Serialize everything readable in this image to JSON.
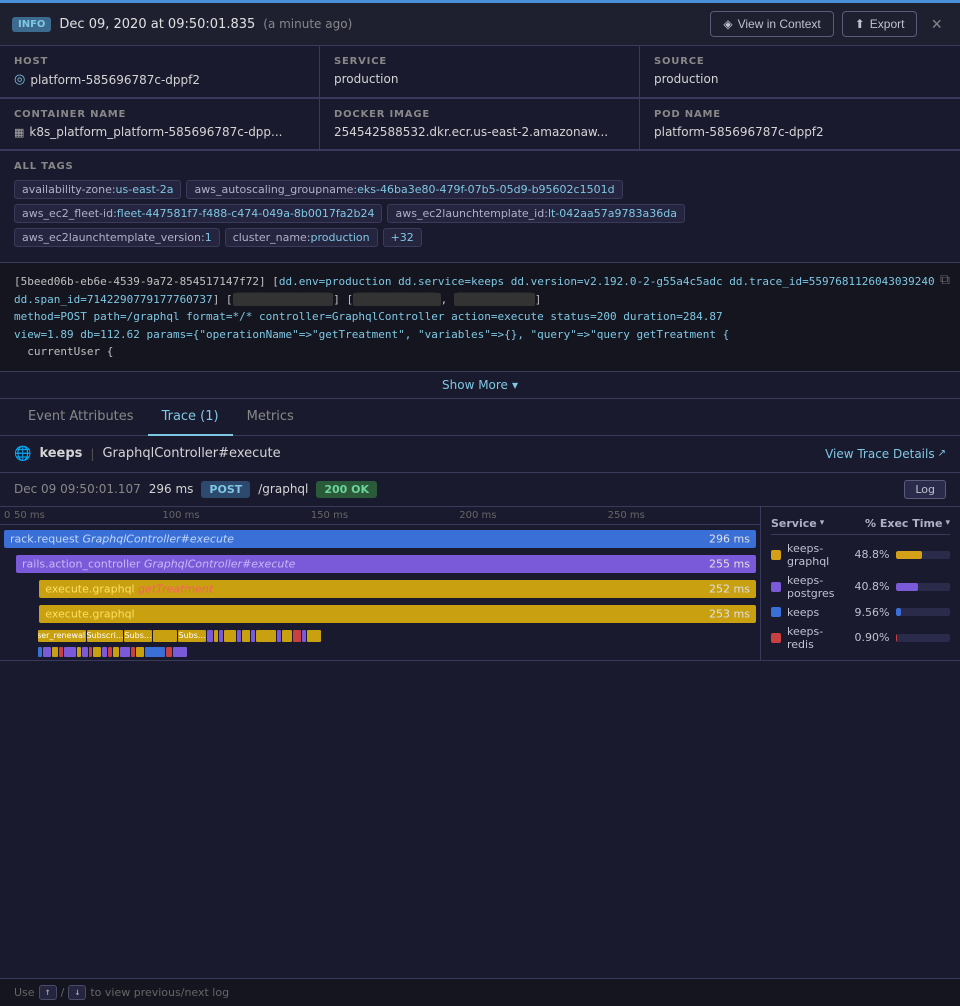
{
  "top_border_color": "#4a90d9",
  "header": {
    "info_label": "INFO",
    "timestamp": "Dec 09, 2020 at 09:50:01.835",
    "relative_time": "(a minute ago)",
    "view_context_label": "View in Context",
    "export_label": "Export",
    "close_label": "×"
  },
  "meta": {
    "row1": [
      {
        "label": "HOST",
        "value": "platform-585696787c-dppf2",
        "icon": "○"
      },
      {
        "label": "SERVICE",
        "value": "production",
        "icon": ""
      },
      {
        "label": "SOURCE",
        "value": "production",
        "icon": ""
      }
    ],
    "row2": [
      {
        "label": "CONTAINER NAME",
        "value": "k8s_platform_platform-585696787c-dpp...",
        "icon": "▦"
      },
      {
        "label": "DOCKER IMAGE",
        "value": "254542588532.dkr.ecr.us-east-2.amazonaw...",
        "icon": ""
      },
      {
        "label": "POD NAME",
        "value": "platform-585696787c-dppf2",
        "icon": ""
      }
    ]
  },
  "tags": {
    "label": "ALL TAGS",
    "items": [
      {
        "key": "availability-zone",
        "val": "us-east-2a"
      },
      {
        "key": "aws_autoscaling_groupname",
        "val": "eks-46ba3e80-479f-07b5-05d9-b95602c1501d"
      },
      {
        "key": "aws_ec2_fleet-id",
        "val": "fleet-447581f7-f488-c474-049a-8b0017fa2b24"
      },
      {
        "key": "aws_ec2launchtemplate_id",
        "val": "lt-042aa57a9783a36da"
      },
      {
        "key": "aws_ec2launchtemplate_version",
        "val": "1"
      },
      {
        "key": "cluster_name",
        "val": "production"
      }
    ],
    "more_label": "+32"
  },
  "log": {
    "hash": "[5beed06b-eb6e-4539-9a72-854517147f72]",
    "dd_env": "dd.env=production",
    "dd_service": "dd.service=keeps",
    "dd_version": "dd.version=v2.192.0-2-g55a4c5adc",
    "dd_trace_id": "dd.trace_id=559768112604303924​0",
    "dd_span_id": "dd.span_id=71422907791777607​37",
    "method": "method=POST",
    "path": "path=/graphql",
    "format": "format=*/*",
    "controller": "controller=GraphqlController",
    "action": "action=execute",
    "status": "status=200",
    "duration": "duration=284.87",
    "view": "view=1.89",
    "db": "db=112.62",
    "params": "params={\"operationName\"=>\"getTreatment\", \"variables\"=>{}, \"query\"=>\"query getTreatment {",
    "ellipsis": "  currentUser {",
    "show_more": "Show More"
  },
  "tabs": {
    "items": [
      {
        "label": "Event Attributes",
        "active": false
      },
      {
        "label": "Trace (1)",
        "active": true
      },
      {
        "label": "Metrics",
        "active": false
      }
    ]
  },
  "trace": {
    "globe_icon": "🌐",
    "service": "keeps",
    "separator": "|",
    "operation": "GraphqlController#execute",
    "view_details_label": "View Trace Details",
    "date": "Dec 09 09:50:01.107",
    "duration": "296 ms",
    "method": "POST",
    "path": "/graphql",
    "status": "200 OK",
    "log_label": "Log",
    "ruler": [
      "0",
      "50 ms",
      "100 ms",
      "150 ms",
      "200 ms",
      "250 ms"
    ],
    "rows": [
      {
        "indent": 0,
        "color": "blue",
        "left_pct": 0,
        "width_pct": 100,
        "label": "rack.request GraphqlController#execute",
        "label_color": "#c0d8f8",
        "dur": "296 ms"
      },
      {
        "indent": 1,
        "color": "purple",
        "left_pct": 0,
        "width_pct": 86,
        "label": "rails.action_controller GraphqlController#execute",
        "label_color": "#c8b8f8",
        "dur": "255 ms"
      },
      {
        "indent": 2,
        "color": "yellow",
        "left_pct": 2,
        "width_pct": 84,
        "label": "execute.graphql getTreatment",
        "label_color": "#f8e060",
        "dur": "252 ms"
      },
      {
        "indent": 2,
        "color": "yellow",
        "left_pct": 2,
        "width_pct": 84,
        "label": "execute.graphql",
        "label_color": "#f8e060",
        "dur": "253 ms"
      }
    ],
    "legend": {
      "col_service": "Service",
      "col_exec": "% Exec Time",
      "items": [
        {
          "name": "keeps-graphql",
          "pct_text": "48.8%",
          "pct_val": 48.8,
          "color": "#d4a017"
        },
        {
          "name": "keeps-postgre​s",
          "pct_text": "40.8%",
          "pct_val": 40.8,
          "color": "#7a5ad8"
        },
        {
          "name": "keeps",
          "pct_text": "9.56%",
          "pct_val": 9.56,
          "color": "#3a6fd8"
        },
        {
          "name": "keeps-redis",
          "pct_text": "0.90%",
          "pct_val": 0.9,
          "color": "#c84040"
        }
      ]
    }
  },
  "footer": {
    "prefix": "Use",
    "up_key": "↑",
    "slash": "/",
    "down_key": "↓",
    "suffix": "to view previous/next log"
  }
}
